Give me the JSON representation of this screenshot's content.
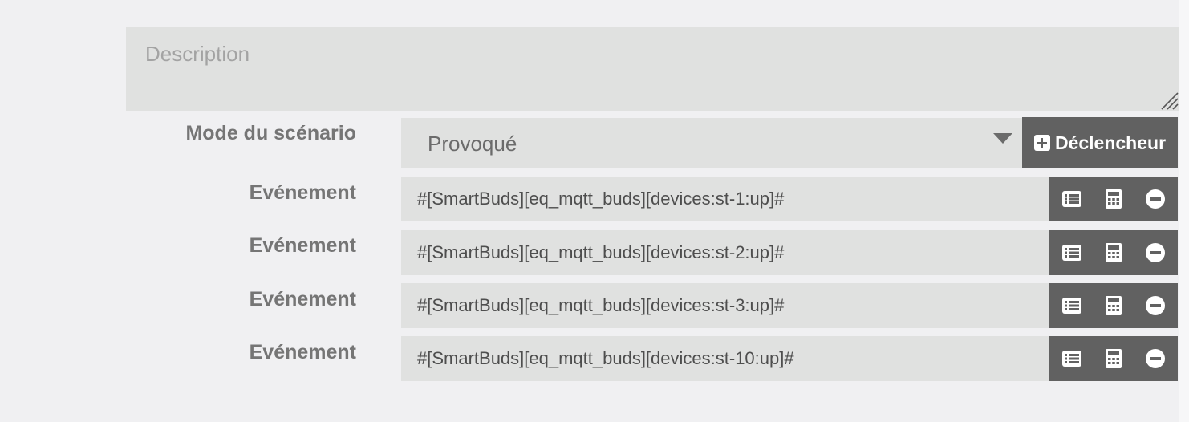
{
  "description": {
    "placeholder": "Description",
    "value": ""
  },
  "mode": {
    "label": "Mode du scénario",
    "selected": "Provoqué",
    "trigger_button_label": "Déclencheur"
  },
  "events": [
    {
      "label": "Evénement",
      "value": "#[SmartBuds][eq_mqtt_buds][devices:st-1:up]#"
    },
    {
      "label": "Evénement",
      "value": "#[SmartBuds][eq_mqtt_buds][devices:st-2:up]#"
    },
    {
      "label": "Evénement",
      "value": "#[SmartBuds][eq_mqtt_buds][devices:st-3:up]#"
    },
    {
      "label": "Evénement",
      "value": "#[SmartBuds][eq_mqtt_buds][devices:st-10:up]#"
    }
  ],
  "icons": {
    "trigger": "plus-square-icon",
    "event_actions": [
      "list-icon",
      "calculator-icon",
      "minus-circle-icon"
    ]
  },
  "colors": {
    "page_bg": "#f0f0f2",
    "field_bg": "#e0e1e0",
    "button_bg": "#616161",
    "label_text": "#757575"
  }
}
